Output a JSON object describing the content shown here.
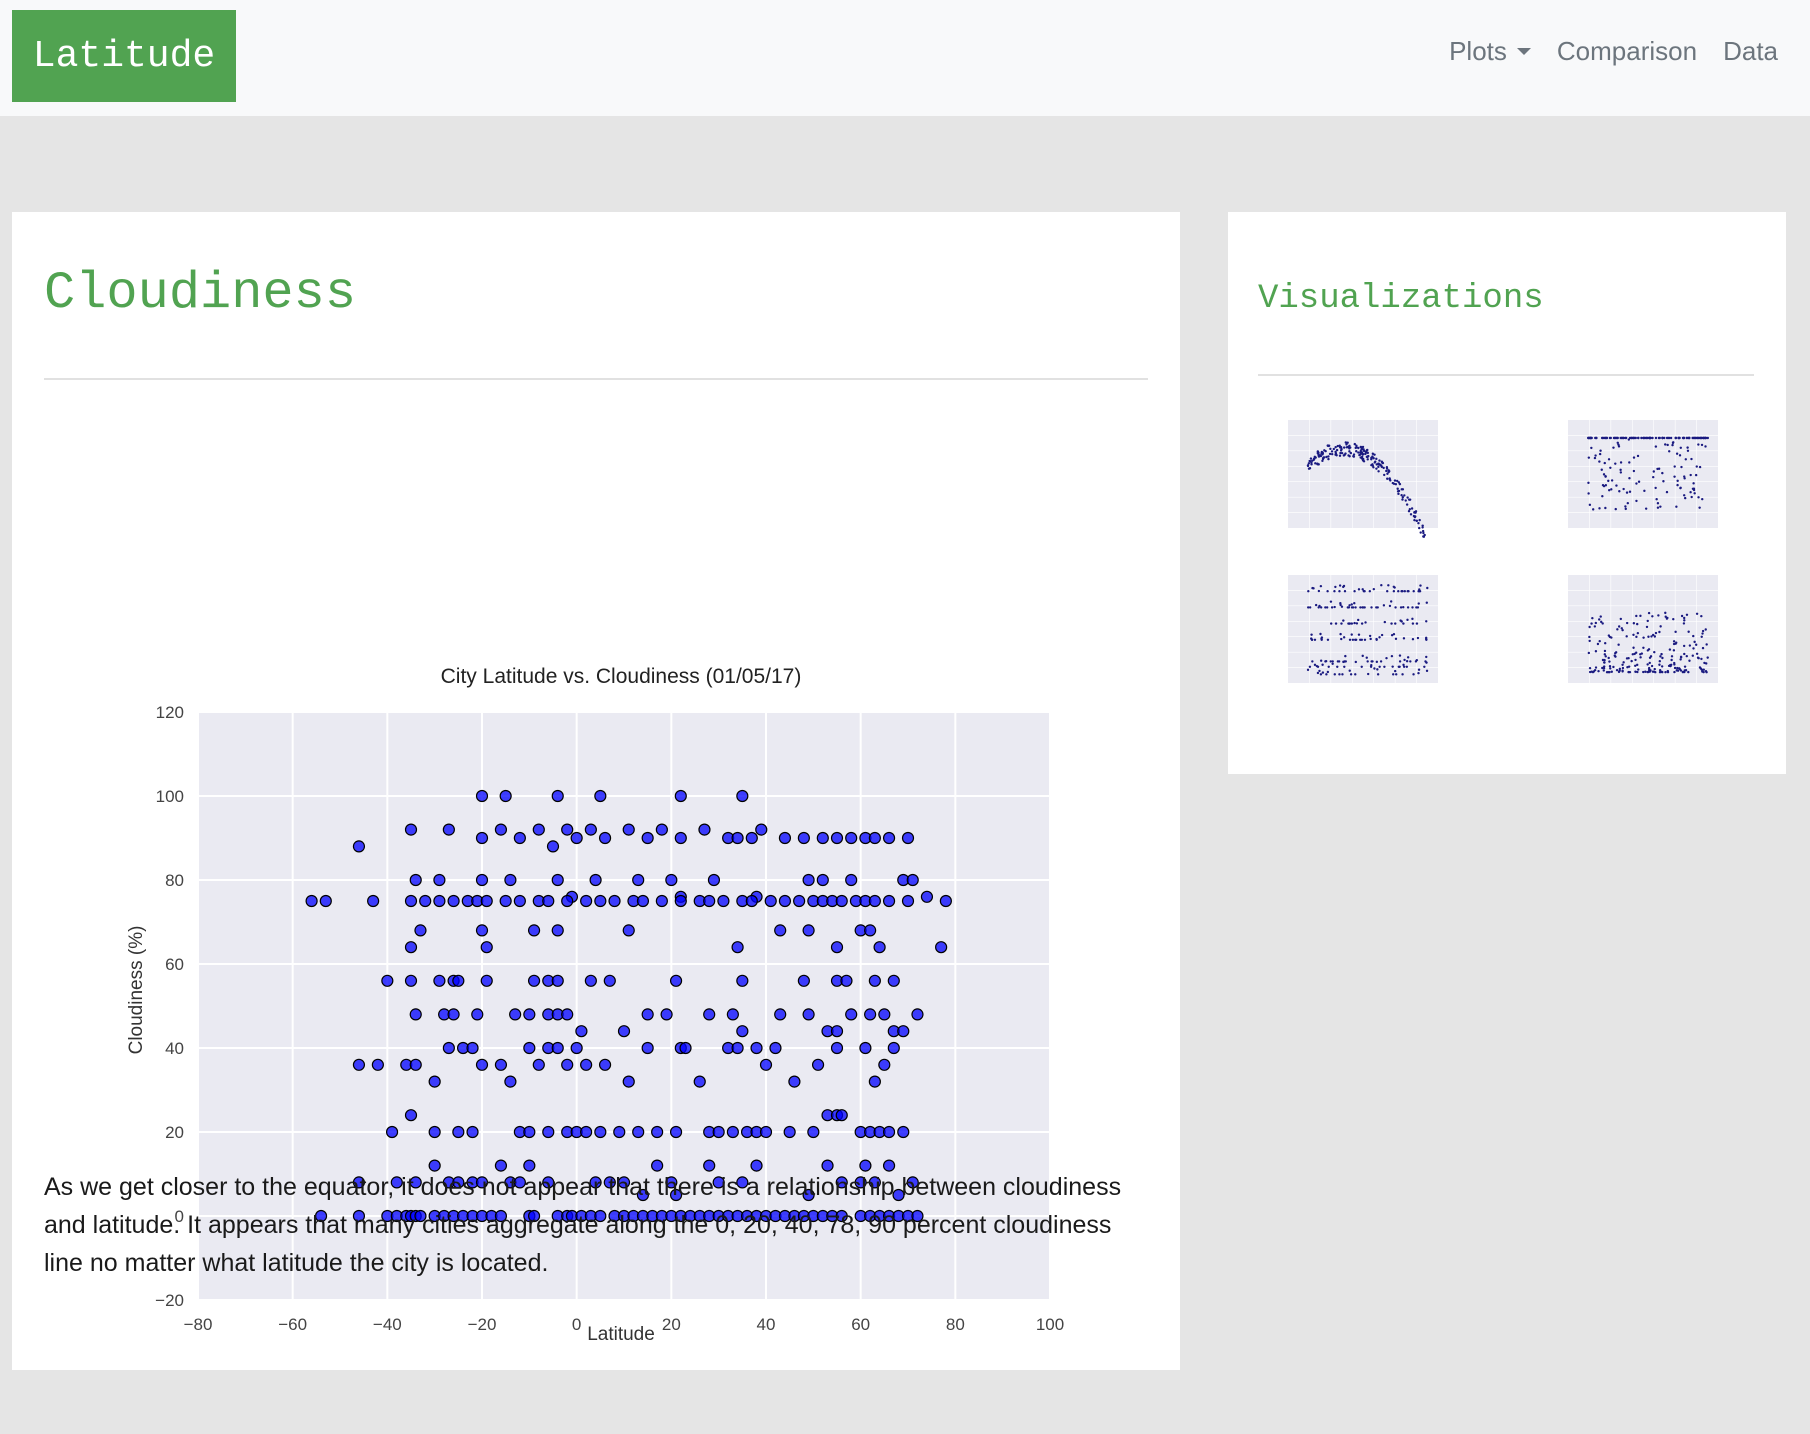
{
  "navbar": {
    "brand": "Latitude",
    "links": [
      {
        "label": "Plots",
        "dropdown": true
      },
      {
        "label": "Comparison"
      },
      {
        "label": "Data"
      }
    ]
  },
  "main": {
    "title": "Cloudiness",
    "description": "As we get closer to the equator, it does not appear that there is a relationship between cloudiness and latitude. It appears that many cities aggregate along the 0, 20, 40, 78, 90 percent cloudiness line no matter what latitude the city is located."
  },
  "sidebar": {
    "title": "Visualizations"
  },
  "colors": {
    "brand": "#51a351",
    "plot_bg": "#eaeaf2",
    "marker": "#0000ff",
    "thumb_marker": "#1a1a80"
  },
  "chart_data": {
    "type": "scatter",
    "title": "City Latitude vs. Cloudiness (01/05/17)",
    "xlabel": "Latitude",
    "ylabel": "Cloudiness (%)",
    "xlim": [
      -80,
      100
    ],
    "ylim": [
      -20,
      120
    ],
    "xticks": [
      "−80",
      "−60",
      "−40",
      "−20",
      "0",
      "20",
      "40",
      "60",
      "80",
      "100"
    ],
    "yticks": [
      "−20",
      "0",
      "20",
      "40",
      "60",
      "80",
      "100",
      "120"
    ],
    "grid": true,
    "x": [
      -54,
      -46,
      -40,
      -38,
      -36,
      -35,
      -34,
      -33,
      -30,
      -28,
      -26,
      -24,
      -22,
      -20,
      -18,
      -16,
      -10,
      -9,
      -4,
      -2,
      -1,
      1,
      3,
      5,
      8,
      10,
      12,
      14,
      16,
      18,
      20,
      22,
      24,
      26,
      28,
      30,
      32,
      34,
      36,
      38,
      40,
      42,
      44,
      46,
      48,
      50,
      52,
      54,
      56,
      60,
      62,
      64,
      66,
      68,
      70,
      72,
      -46,
      -38,
      -34,
      -30,
      -27,
      -25,
      -22,
      -20,
      -16,
      -14,
      -12,
      -10,
      -6,
      4,
      7,
      10,
      14,
      17,
      20,
      21,
      28,
      30,
      35,
      38,
      49,
      53,
      56,
      60,
      61,
      63,
      66,
      68,
      71,
      -39,
      -35,
      -30,
      -25,
      -22,
      -12,
      -10,
      -6,
      -2,
      0,
      2,
      5,
      9,
      13,
      17,
      21,
      28,
      30,
      33,
      36,
      38,
      40,
      45,
      50,
      53,
      55,
      56,
      60,
      62,
      64,
      66,
      69,
      -46,
      -42,
      -36,
      -34,
      -30,
      -27,
      -24,
      -22,
      -20,
      -16,
      -14,
      -10,
      -8,
      -6,
      -4,
      -2,
      0,
      2,
      6,
      11,
      15,
      22,
      26,
      32,
      34,
      38,
      40,
      42,
      46,
      51,
      55,
      61,
      63,
      65,
      67,
      -34,
      -28,
      -26,
      -21,
      -13,
      -10,
      -6,
      -4,
      -2,
      1,
      10,
      15,
      19,
      23,
      28,
      33,
      35,
      43,
      49,
      53,
      55,
      58,
      62,
      65,
      67,
      69,
      72,
      -40,
      -35,
      -29,
      -26,
      -25,
      -19,
      -9,
      -6,
      -4,
      3,
      7,
      21,
      35,
      48,
      55,
      57,
      63,
      67,
      -35,
      -33,
      -20,
      -19,
      -9,
      -4,
      -1,
      11,
      22,
      34,
      38,
      43,
      49,
      55,
      60,
      62,
      64,
      77,
      -56,
      -53,
      -43,
      -35,
      -32,
      -29,
      -26,
      -23,
      -21,
      -19,
      -15,
      -12,
      -8,
      -6,
      -2,
      2,
      5,
      8,
      12,
      14,
      18,
      22,
      26,
      28,
      31,
      35,
      37,
      41,
      44,
      47,
      50,
      52,
      54,
      56,
      59,
      61,
      63,
      66,
      70,
      74,
      78,
      -34,
      -29,
      -20,
      -14,
      -4,
      4,
      13,
      20,
      29,
      49,
      52,
      58,
      69,
      71,
      -46,
      -35,
      -27,
      -20,
      -16,
      -12,
      -8,
      -5,
      -2,
      0,
      3,
      6,
      11,
      15,
      18,
      22,
      27,
      32,
      34,
      37,
      39,
      44,
      48,
      52,
      55,
      58,
      61,
      63,
      66,
      70,
      -20,
      -15,
      -4,
      5,
      22,
      35
    ],
    "y": [
      0,
      0,
      0,
      0,
      0,
      0,
      0,
      0,
      0,
      0,
      0,
      0,
      0,
      0,
      0,
      0,
      0,
      0,
      0,
      0,
      0,
      0,
      0,
      0,
      0,
      0,
      0,
      0,
      0,
      0,
      0,
      0,
      0,
      0,
      0,
      0,
      0,
      0,
      0,
      0,
      0,
      0,
      0,
      0,
      0,
      0,
      0,
      0,
      0,
      0,
      0,
      0,
      0,
      0,
      0,
      0,
      8,
      8,
      8,
      12,
      8,
      8,
      8,
      8,
      12,
      8,
      8,
      12,
      8,
      8,
      8,
      8,
      5,
      12,
      8,
      5,
      12,
      8,
      8,
      12,
      5,
      12,
      8,
      8,
      12,
      8,
      12,
      5,
      8,
      20,
      24,
      20,
      20,
      20,
      20,
      20,
      20,
      20,
      20,
      20,
      20,
      20,
      20,
      20,
      20,
      20,
      20,
      20,
      20,
      20,
      20,
      20,
      20,
      24,
      24,
      24,
      20,
      20,
      20,
      20,
      20,
      36,
      36,
      36,
      36,
      32,
      40,
      40,
      40,
      36,
      36,
      32,
      40,
      36,
      40,
      40,
      36,
      40,
      36,
      36,
      32,
      40,
      40,
      32,
      40,
      40,
      40,
      36,
      40,
      32,
      36,
      40,
      40,
      32,
      36,
      40,
      48,
      48,
      48,
      48,
      48,
      48,
      48,
      48,
      48,
      44,
      44,
      48,
      48,
      40,
      48,
      48,
      44,
      48,
      48,
      44,
      44,
      48,
      48,
      48,
      44,
      44,
      48,
      56,
      56,
      56,
      56,
      56,
      56,
      56,
      56,
      56,
      56,
      56,
      56,
      56,
      56,
      56,
      56,
      56,
      56,
      64,
      68,
      68,
      64,
      68,
      68,
      76,
      68,
      76,
      64,
      76,
      68,
      68,
      64,
      68,
      68,
      64,
      64,
      75,
      75,
      75,
      75,
      75,
      75,
      75,
      75,
      75,
      75,
      75,
      75,
      75,
      75,
      75,
      75,
      75,
      75,
      75,
      75,
      75,
      75,
      75,
      75,
      75,
      75,
      75,
      75,
      75,
      75,
      75,
      75,
      75,
      75,
      75,
      75,
      75,
      75,
      75,
      76,
      75,
      80,
      80,
      80,
      80,
      80,
      80,
      80,
      80,
      80,
      80,
      80,
      80,
      80,
      80,
      88,
      92,
      92,
      90,
      92,
      90,
      92,
      88,
      92,
      90,
      92,
      90,
      92,
      90,
      92,
      90,
      92,
      90,
      90,
      90,
      92,
      90,
      90,
      90,
      90,
      90,
      90,
      90,
      90,
      90,
      100,
      100,
      100,
      100,
      100,
      100
    ]
  }
}
